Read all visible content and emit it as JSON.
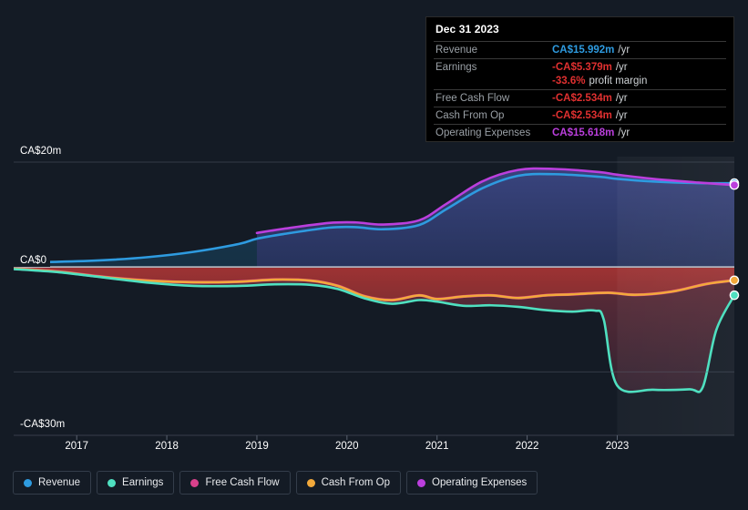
{
  "background_color": "#141b25",
  "tooltip": {
    "title": "Dec 31 2023",
    "rows": [
      {
        "key": "Revenue",
        "value": "CA$15.992m",
        "unit": "/yr",
        "color": "#2e9be0"
      },
      {
        "key": "Earnings",
        "value": "-CA$5.379m",
        "unit": "/yr",
        "color": "#e03030"
      },
      {
        "key": "",
        "value": "-33.6%",
        "unit": "profit margin",
        "color": "#e03030"
      },
      {
        "key": "Free Cash Flow",
        "value": "-CA$2.534m",
        "unit": "/yr",
        "color": "#e03030"
      },
      {
        "key": "Cash From Op",
        "value": "-CA$2.534m",
        "unit": "/yr",
        "color": "#e03030"
      },
      {
        "key": "Operating Expenses",
        "value": "CA$15.618m",
        "unit": "/yr",
        "color": "#bb3fdd"
      }
    ]
  },
  "legend": {
    "items": [
      {
        "label": "Revenue",
        "color": "#2e9be0"
      },
      {
        "label": "Earnings",
        "color": "#4fe0c0"
      },
      {
        "label": "Free Cash Flow",
        "color": "#d9418c"
      },
      {
        "label": "Cash From Op",
        "color": "#f2a93b"
      },
      {
        "label": "Operating Expenses",
        "color": "#bb3fdd"
      }
    ]
  },
  "chart_data": {
    "type": "area",
    "title": "",
    "xlabel": "",
    "ylabel": "",
    "currency": "CA$",
    "ylim": [
      -30,
      20
    ],
    "y_ticks": [
      {
        "label": "CA$20m",
        "value": 20
      },
      {
        "label": "CA$0",
        "value": 0
      },
      {
        "label": "-CA$30m",
        "value": -30
      }
    ],
    "y_gridlines": [
      20,
      0,
      -20
    ],
    "x_ticks": [
      "2017",
      "2018",
      "2019",
      "2020",
      "2021",
      "2022",
      "2023"
    ],
    "x_range": [
      "2016.3",
      "2024.3"
    ],
    "forecast_starts": "2023.0",
    "grid": true,
    "legend_position": "bottom-left",
    "series": [
      {
        "name": "Revenue",
        "color": "#2e9be0",
        "x": [
          2016.3,
          2016.8,
          2017.3,
          2017.8,
          2018.3,
          2018.8,
          2019.0,
          2019.3,
          2019.8,
          2020.1,
          2020.4,
          2020.8,
          2021.1,
          2021.5,
          2021.9,
          2022.3,
          2022.8,
          2023.0,
          2023.4,
          2023.9,
          2024.3
        ],
        "y": [
          0.9,
          1.0,
          1.3,
          1.9,
          2.9,
          4.4,
          5.4,
          6.3,
          7.5,
          7.6,
          7.2,
          8.0,
          11.0,
          15.0,
          17.4,
          17.7,
          17.2,
          16.8,
          16.3,
          16.0,
          15.992
        ]
      },
      {
        "name": "Operating Expenses",
        "color": "#bb3fdd",
        "x": [
          2019.0,
          2019.3,
          2019.8,
          2020.1,
          2020.4,
          2020.8,
          2021.1,
          2021.5,
          2021.9,
          2022.3,
          2022.8,
          2023.0,
          2023.4,
          2023.9,
          2024.3
        ],
        "y": [
          6.5,
          7.3,
          8.4,
          8.5,
          8.1,
          8.9,
          12.0,
          16.3,
          18.5,
          18.7,
          18.1,
          17.6,
          16.8,
          16.1,
          15.618
        ]
      },
      {
        "name": "Earnings",
        "color": "#4fe0c0",
        "x": [
          2016.3,
          2016.8,
          2017.3,
          2017.8,
          2018.3,
          2018.8,
          2019.2,
          2019.6,
          2019.9,
          2020.2,
          2020.5,
          2020.8,
          2021.0,
          2021.3,
          2021.6,
          2021.9,
          2022.2,
          2022.5,
          2022.75,
          2022.85,
          2023.0,
          2023.4,
          2023.8,
          2023.95,
          2024.1,
          2024.3
        ],
        "y": [
          -0.4,
          -1.0,
          -2.0,
          -3.0,
          -3.6,
          -3.6,
          -3.3,
          -3.4,
          -4.2,
          -6.0,
          -7.0,
          -6.3,
          -6.6,
          -7.4,
          -7.3,
          -7.6,
          -8.2,
          -8.5,
          -8.3,
          -10.0,
          -22.6,
          -23.4,
          -23.3,
          -22.9,
          -12.0,
          -5.379
        ]
      },
      {
        "name": "Cash From Op",
        "color": "#f2a93b",
        "x": [
          2016.3,
          2016.8,
          2017.3,
          2017.8,
          2018.3,
          2018.8,
          2019.2,
          2019.6,
          2019.9,
          2020.2,
          2020.5,
          2020.8,
          2021.0,
          2021.3,
          2021.6,
          2021.9,
          2022.2,
          2022.5,
          2022.9,
          2023.2,
          2023.6,
          2024.0,
          2024.3
        ],
        "y": [
          -0.3,
          -0.9,
          -1.9,
          -2.6,
          -2.9,
          -2.8,
          -2.4,
          -2.6,
          -3.6,
          -5.6,
          -6.3,
          -5.4,
          -6.1,
          -5.6,
          -5.4,
          -5.9,
          -5.4,
          -5.2,
          -4.9,
          -5.3,
          -4.7,
          -3.2,
          -2.534
        ]
      },
      {
        "name": "Free Cash Flow",
        "color": "#d9418c",
        "x": [
          2016.3,
          2016.8,
          2017.3,
          2017.8,
          2018.3,
          2018.8,
          2019.2,
          2019.6,
          2019.9,
          2020.2,
          2020.5,
          2020.8,
          2021.0,
          2021.3,
          2021.6,
          2021.9,
          2022.2,
          2022.5,
          2022.9,
          2023.2,
          2023.6,
          2024.0,
          2024.3
        ],
        "y": [
          -0.3,
          -0.9,
          -1.9,
          -2.6,
          -2.9,
          -2.8,
          -2.4,
          -2.6,
          -3.6,
          -5.6,
          -6.3,
          -5.4,
          -6.1,
          -5.6,
          -5.4,
          -5.9,
          -5.4,
          -5.2,
          -4.9,
          -5.3,
          -4.7,
          -3.2,
          -2.534
        ]
      }
    ]
  }
}
